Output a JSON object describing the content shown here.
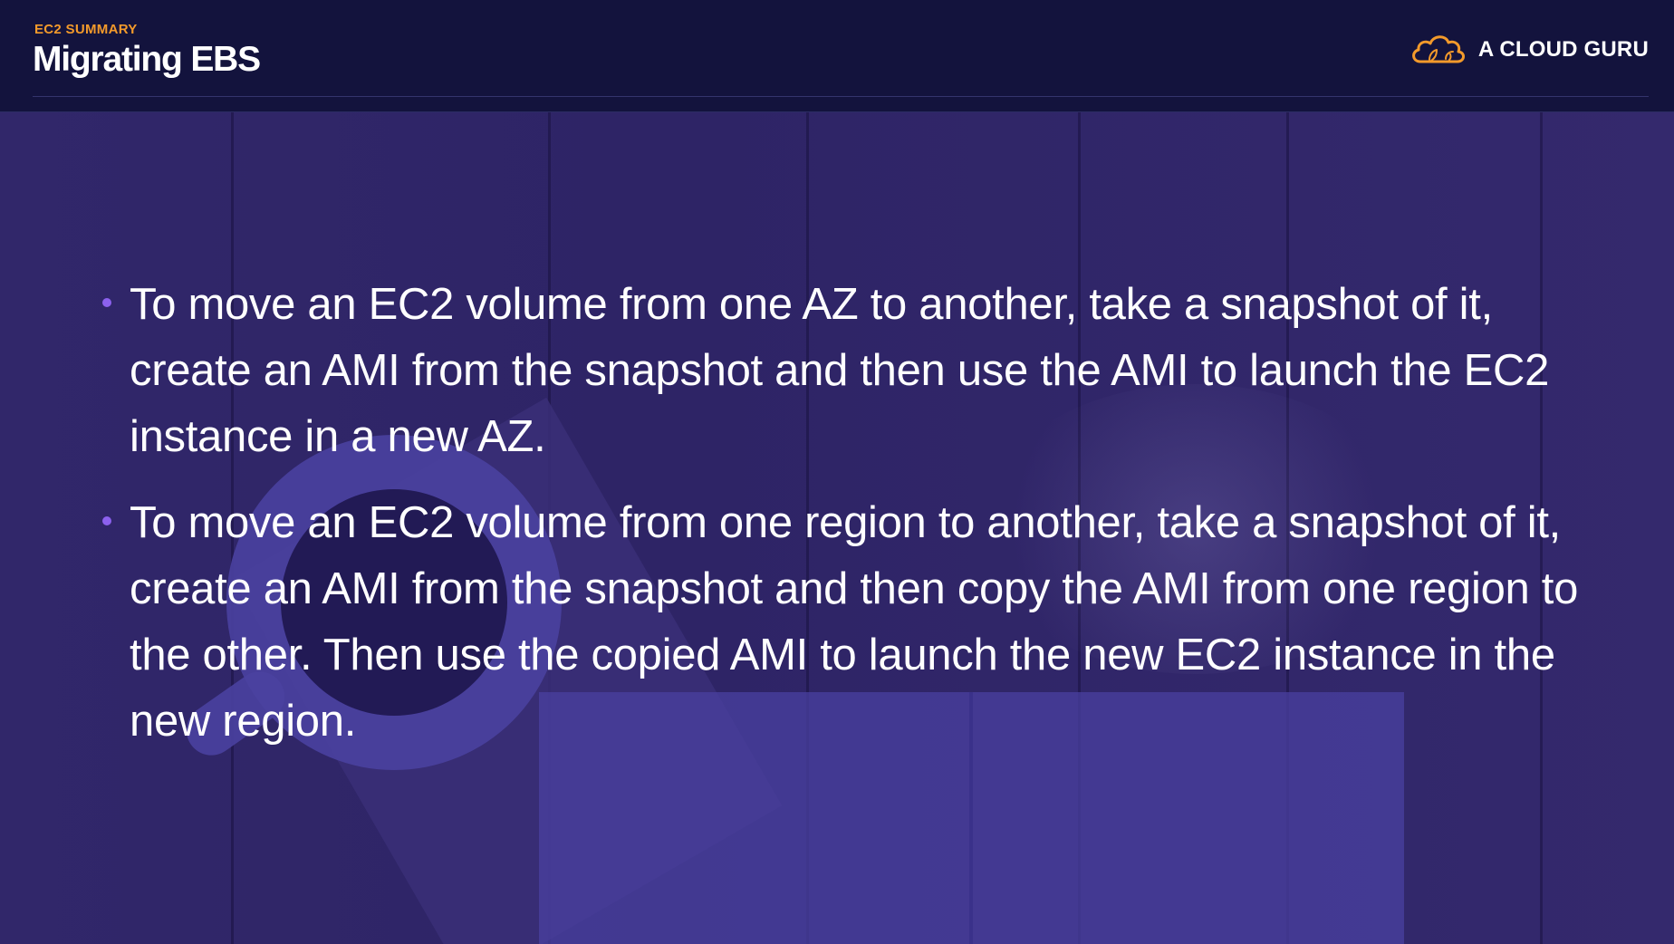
{
  "header": {
    "eyebrow": "EC2 SUMMARY",
    "title": "Migrating EBS"
  },
  "brand": {
    "name": "A CLOUD GURU",
    "icon": "cloud-logo-icon",
    "accent_color": "#f39a2b"
  },
  "colors": {
    "header_background": "#13133d",
    "bullet_dot": "#8c61ee",
    "body_text": "#ffffff"
  },
  "bullets": [
    "To move an EC2 volume from one AZ to another, take a snapshot of it, create an AMI from the snapshot and then use the AMI to launch the EC2 instance in a new AZ.",
    "To move an EC2 volume from one region to another, take a snapshot of it, create an AMI from the snapshot and then copy the AMI from one region to the other. Then use the copied AMI to launch the new EC2 instance in the new region."
  ]
}
